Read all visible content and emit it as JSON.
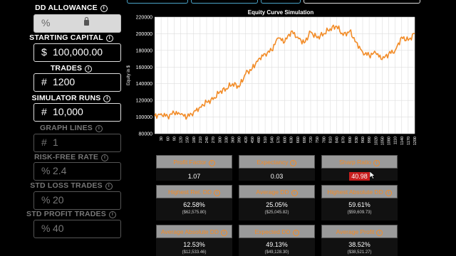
{
  "left_panel": {
    "dd_allowance": {
      "label": "DD ALLOWANCE",
      "prefix": "%",
      "value": ""
    },
    "starting_capital": {
      "label": "STARTING CAPITAL",
      "prefix": "$",
      "value": "100,000.00"
    },
    "trades": {
      "label": "TRADES",
      "prefix": "#",
      "value": "1200"
    },
    "simulator_runs": {
      "label": "SIMULATOR RUNS",
      "prefix": "#",
      "value": "10,000"
    },
    "graph_lines": {
      "label": "GRAPH LINES",
      "prefix": "#",
      "value": "1"
    },
    "risk_free_rate": {
      "label": "RISK-FREE RATE",
      "prefix": "%",
      "value": "2.4"
    },
    "std_loss_trades": {
      "label": "STD LOSS TRADES",
      "prefix": "%",
      "value": "20"
    },
    "std_profit_trades": {
      "label": "STD PROFIT TRADES",
      "prefix": "%",
      "value": "40"
    },
    "info_glyph": "i"
  },
  "chart_data": {
    "type": "line",
    "title": "Equity Curve Simulation",
    "ylabel": "Equity in $",
    "xlabel": "",
    "ylim": [
      80000,
      220000
    ],
    "yticks": [
      80000,
      100000,
      120000,
      140000,
      160000,
      180000,
      200000,
      220000
    ],
    "xticks": [
      30,
      60,
      90,
      120,
      150,
      180,
      210,
      240,
      270,
      300,
      330,
      360,
      390,
      420,
      450,
      480,
      510,
      540,
      570,
      600,
      630,
      660,
      690,
      720,
      750,
      780,
      810,
      840,
      870,
      900,
      930,
      960,
      990,
      1020,
      1050,
      1080,
      1110,
      1140,
      1170,
      1200
    ],
    "xlim": [
      0,
      1200
    ],
    "grid": true,
    "series": [
      {
        "color": "#f28c28",
        "x": [
          0,
          30,
          60,
          90,
          120,
          150,
          180,
          210,
          240,
          270,
          300,
          330,
          360,
          390,
          420,
          450,
          480,
          510,
          540,
          570,
          600,
          630,
          660,
          690,
          720,
          750,
          780,
          810,
          840,
          870,
          900,
          930,
          960,
          990,
          1020,
          1050,
          1080,
          1110,
          1140,
          1170,
          1200
        ],
        "y": [
          101000,
          104000,
          101000,
          105000,
          103000,
          100000,
          106000,
          112000,
          118000,
          121000,
          130000,
          134000,
          140000,
          136000,
          152000,
          158000,
          170000,
          176000,
          180000,
          195000,
          190000,
          203000,
          196000,
          189000,
          202000,
          195000,
          200000,
          206000,
          209000,
          198000,
          203000,
          190000,
          178000,
          174000,
          177000,
          169000,
          176000,
          180000,
          196000,
          192000,
          200000
        ]
      }
    ]
  },
  "cards": [
    {
      "title": "Profit Factor",
      "value": "1.07",
      "sub": ""
    },
    {
      "title": "Expectancy",
      "value": "0.03",
      "sub": ""
    },
    {
      "title": "Sharp Ratio",
      "value": "40.98",
      "sub": ""
    },
    {
      "title": "Highest Rel. DD",
      "value": "62.58%",
      "sub": "($62,575.80)"
    },
    {
      "title": "Average DD",
      "value": "25.05%",
      "sub": "($25,045.82)"
    },
    {
      "title": "Highest Absolute DD",
      "value": "59.61%",
      "sub": "($59,609.73)"
    },
    {
      "title": "Average Absolute DD",
      "value": "12.53%",
      "sub": "($12,533.46)"
    },
    {
      "title": "Expected DD",
      "value": "49.13%",
      "sub": "($49,128.30)"
    },
    {
      "title": "Average Profit",
      "value": "38.52%",
      "sub": "($38,521.27)"
    }
  ],
  "colors": {
    "accent": "#f28c28",
    "highlight": "#c81e1e",
    "tab_border": "#4aa3c8"
  }
}
